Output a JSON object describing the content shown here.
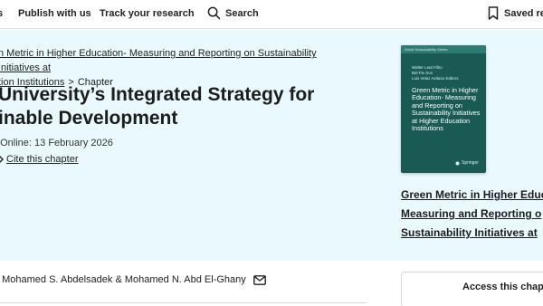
{
  "nav": {
    "publish_label": "Publish with us",
    "track_label": "Track your research",
    "search_label": "Search",
    "saved_label": "Saved res"
  },
  "breadcrumb": {
    "book_line1": "n Metric in Higher Education- Measuring and Reporting on Sustainability Initiatives at",
    "book_line2": "tion Institutions",
    "separator": ">",
    "chapter_label": "Chapter"
  },
  "chapter": {
    "title_line1": "University’s Integrated Strategy for",
    "title_line2": "inable Development",
    "published": "t Online: 13 February 2026",
    "cite_label": "Cite this chapter"
  },
  "book_cover": {
    "series": "World Sustainability Series",
    "editors": [
      "Walter Leal Filho",
      "Bel Fie Sun",
      "Luis Velaz Avitaso",
      "Editors"
    ],
    "title": "Green Metric in Higher Education- Measuring and Reporting on Sustainability Initiatives at Higher Education Institutions",
    "publisher": "Springer",
    "cover_color": "#1a5a55"
  },
  "book_link": {
    "line1": "Green Metric in Higher Educ",
    "line2": "Measuring and Reporting o",
    "line3": "Sustainability Initiatives at"
  },
  "authors": {
    "text": ", Mohamed S. Abdelsadek & Mohamed N. Abd El-Ghany"
  },
  "access": {
    "label": "Access this chapte"
  },
  "colors": {
    "hero_bg": "#eaf9fd"
  }
}
